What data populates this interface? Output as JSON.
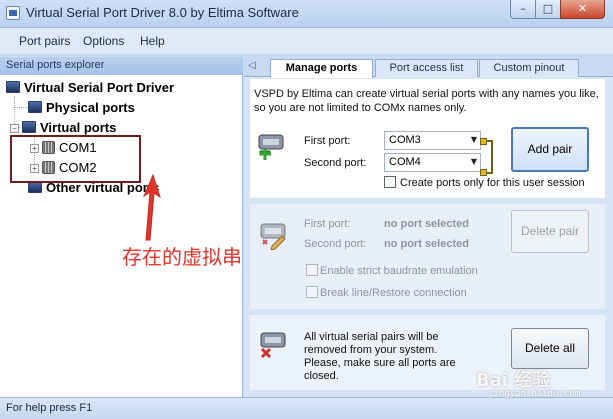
{
  "window": {
    "title": "Virtual Serial Port Driver 8.0 by Eltima Software",
    "minimize_glyph": "–",
    "maximize_glyph": "□",
    "close_glyph": "✕"
  },
  "menu": [
    "Port pairs",
    "Options",
    "Help"
  ],
  "explorer": {
    "header": "Serial ports explorer",
    "root": "Virtual Serial Port Driver",
    "physical": "Physical ports",
    "virtual": "Virtual ports",
    "virtual_children": [
      "COM1",
      "COM2"
    ],
    "other": "Other virtual ports"
  },
  "annotation": {
    "text": "存在的虚拟串口",
    "color": "#e0352b"
  },
  "tabs": {
    "scroll_glyph": "◁",
    "items": [
      "Manage ports",
      "Port access list",
      "Custom pinout"
    ],
    "active": "Manage ports"
  },
  "create": {
    "description": "VSPD by Eltima can create virtual serial ports with any names you like, so you are not limited to COMx names only.",
    "first_label": "First port:",
    "first_value": "COM3",
    "second_label": "Second port:",
    "second_value": "COM4",
    "add_button": "Add pair",
    "checkbox_label": "Create ports only for this user session"
  },
  "delete": {
    "first_label": "First port:",
    "first_value": "no port selected",
    "second_label": "Second port:",
    "second_value": "no port selected",
    "delete_button": "Delete pair",
    "strict_label": "Enable strict baudrate emulation",
    "break_label": "Break line/Restore connection"
  },
  "delete_all": {
    "description": "All virtual serial pairs will be removed from your system. Please, make sure all ports are closed.",
    "button": "Delete all"
  },
  "status": "For help press F1",
  "watermark": {
    "main": "Bai 经验",
    "sub": "jingyan.baidu.com"
  }
}
